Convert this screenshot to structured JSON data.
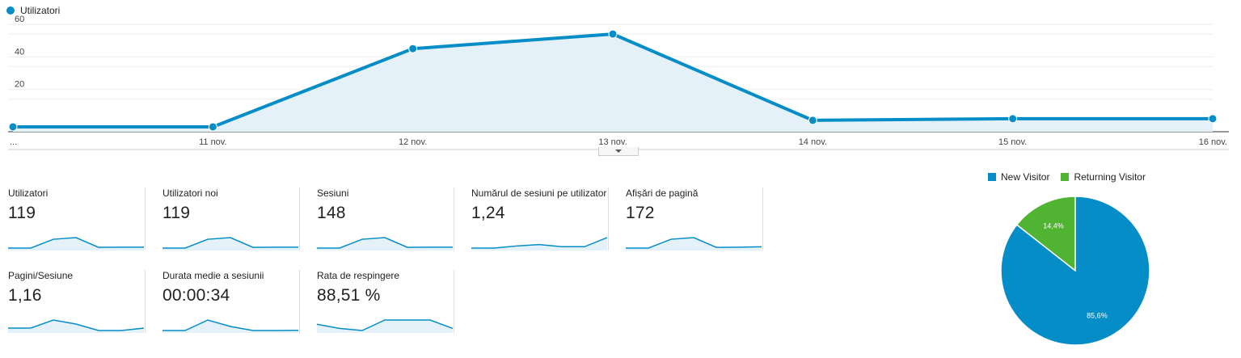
{
  "chart_data": {
    "type": "area",
    "series": [
      {
        "name": "Utilizatori",
        "values": [
          3,
          3,
          51,
          60,
          7,
          8,
          8
        ]
      }
    ],
    "x": [
      "...",
      "11 nov.",
      "12 nov.",
      "13 nov.",
      "14 nov.",
      "15 nov.",
      "16 nov."
    ],
    "x_tick_labels": [
      "...",
      "11 nov.",
      "12 nov.",
      "13 nov.",
      "14 nov.",
      "15 nov.",
      "16 nov."
    ],
    "y_ticks": [
      20,
      40,
      60
    ],
    "ylim": [
      0,
      66
    ],
    "grid": true,
    "legend": "top-left",
    "color": "#058dc7",
    "fill_color": "#e4f1f8"
  },
  "metrics": [
    {
      "label": "Utilizatori",
      "value": "119",
      "spark": [
        3,
        3,
        51,
        60,
        7,
        8,
        8
      ]
    },
    {
      "label": "Utilizatori noi",
      "value": "119",
      "spark": [
        3,
        3,
        51,
        60,
        7,
        8,
        8
      ]
    },
    {
      "label": "Sesiuni",
      "value": "148",
      "spark": [
        3,
        3,
        51,
        60,
        7,
        8,
        8
      ]
    },
    {
      "label": "Numărul de sesiuni pe utilizator",
      "value": "1,24",
      "spark": [
        1.15,
        1.15,
        1.18,
        1.2,
        1.17,
        1.17,
        1.3
      ]
    },
    {
      "label": "Afișări de pagină",
      "value": "172",
      "spark": [
        3,
        3,
        51,
        60,
        7,
        8,
        10
      ]
    },
    {
      "label": "Pagini/Sesiune",
      "value": "1,16",
      "spark": [
        1.15,
        1.15,
        1.25,
        1.2,
        1.12,
        1.12,
        1.15
      ]
    },
    {
      "label": "Durata medie a sesiunii",
      "value": "00:00:34",
      "spark": [
        3,
        3,
        60,
        25,
        3,
        3,
        4
      ]
    },
    {
      "label": "Rata de respingere",
      "value": "88,51 %",
      "spark": [
        88,
        87,
        86.5,
        89,
        89,
        89,
        87
      ]
    }
  ],
  "pie": {
    "type": "pie",
    "legend": [
      {
        "name": "New Visitor",
        "color": "#058dc7"
      },
      {
        "name": "Returning Visitor",
        "color": "#50b432"
      }
    ],
    "slices": [
      {
        "name": "New Visitor",
        "value": 85.6,
        "label": "85,6%",
        "color": "#058dc7"
      },
      {
        "name": "Returning Visitor",
        "value": 14.4,
        "label": "14,4%",
        "color": "#50b432"
      }
    ]
  }
}
